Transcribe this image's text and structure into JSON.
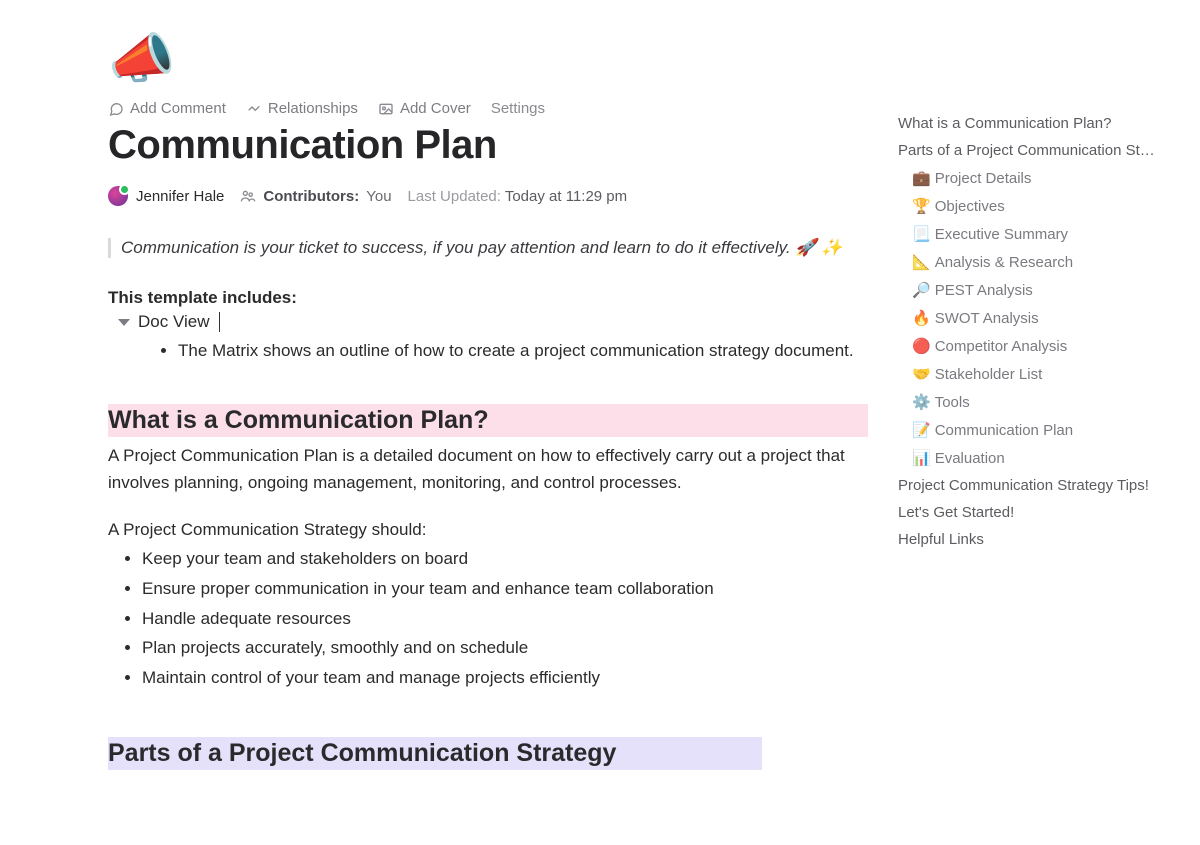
{
  "page_icon": "📣",
  "toolbar": {
    "add_comment": "Add Comment",
    "relationships": "Relationships",
    "add_cover": "Add Cover",
    "settings": "Settings"
  },
  "title": "Communication Plan",
  "author": {
    "name": "Jennifer Hale"
  },
  "contributors": {
    "label": "Contributors:",
    "value": "You"
  },
  "updated": {
    "label": "Last Updated:",
    "value": "Today at 11:29 pm"
  },
  "quote": "Communication is your ticket to success, if you pay attention and learn to do it effectively. 🚀 ✨",
  "template_includes_label": "This template includes:",
  "doc_view_label": "Doc View",
  "matrix_bullet": "The Matrix shows an outline of how to create a project communication strategy document.",
  "section1": {
    "heading": "What is a Communication Plan?",
    "body": "A Project Communication Plan is a detailed document on how to effectively carry out a project that involves planning, ongoing management, monitoring, and control processes.",
    "lead": "A Project Communication Strategy should:",
    "bullets": [
      "Keep your team and stakeholders on board",
      "Ensure proper communication in your team and enhance team collaboration",
      "Handle adequate resources",
      "Plan projects accurately, smoothly and on schedule",
      "Maintain control of your team and manage projects efficiently"
    ]
  },
  "section2": {
    "heading": "Parts of a Project Communication Strategy"
  },
  "outline": {
    "top": [
      "What is a Communication Plan?",
      "Parts of a Project Communication St…"
    ],
    "subs": [
      {
        "emoji": "💼",
        "label": "Project Details"
      },
      {
        "emoji": "🏆",
        "label": "Objectives"
      },
      {
        "emoji": "📃",
        "label": "Executive Summary"
      },
      {
        "emoji": "📐",
        "label": "Analysis & Research"
      },
      {
        "emoji": "🔎",
        "label": "PEST Analysis"
      },
      {
        "emoji": "🔥",
        "label": "SWOT Analysis"
      },
      {
        "emoji": "🔴",
        "label": "Competitor Analysis"
      },
      {
        "emoji": "🤝",
        "label": "Stakeholder List"
      },
      {
        "emoji": "⚙️",
        "label": "Tools"
      },
      {
        "emoji": "📝",
        "label": "Communication Plan"
      },
      {
        "emoji": "📊",
        "label": "Evaluation"
      }
    ],
    "bottom": [
      "Project Communication Strategy Tips!",
      "Let's Get Started!",
      "Helpful Links"
    ]
  }
}
